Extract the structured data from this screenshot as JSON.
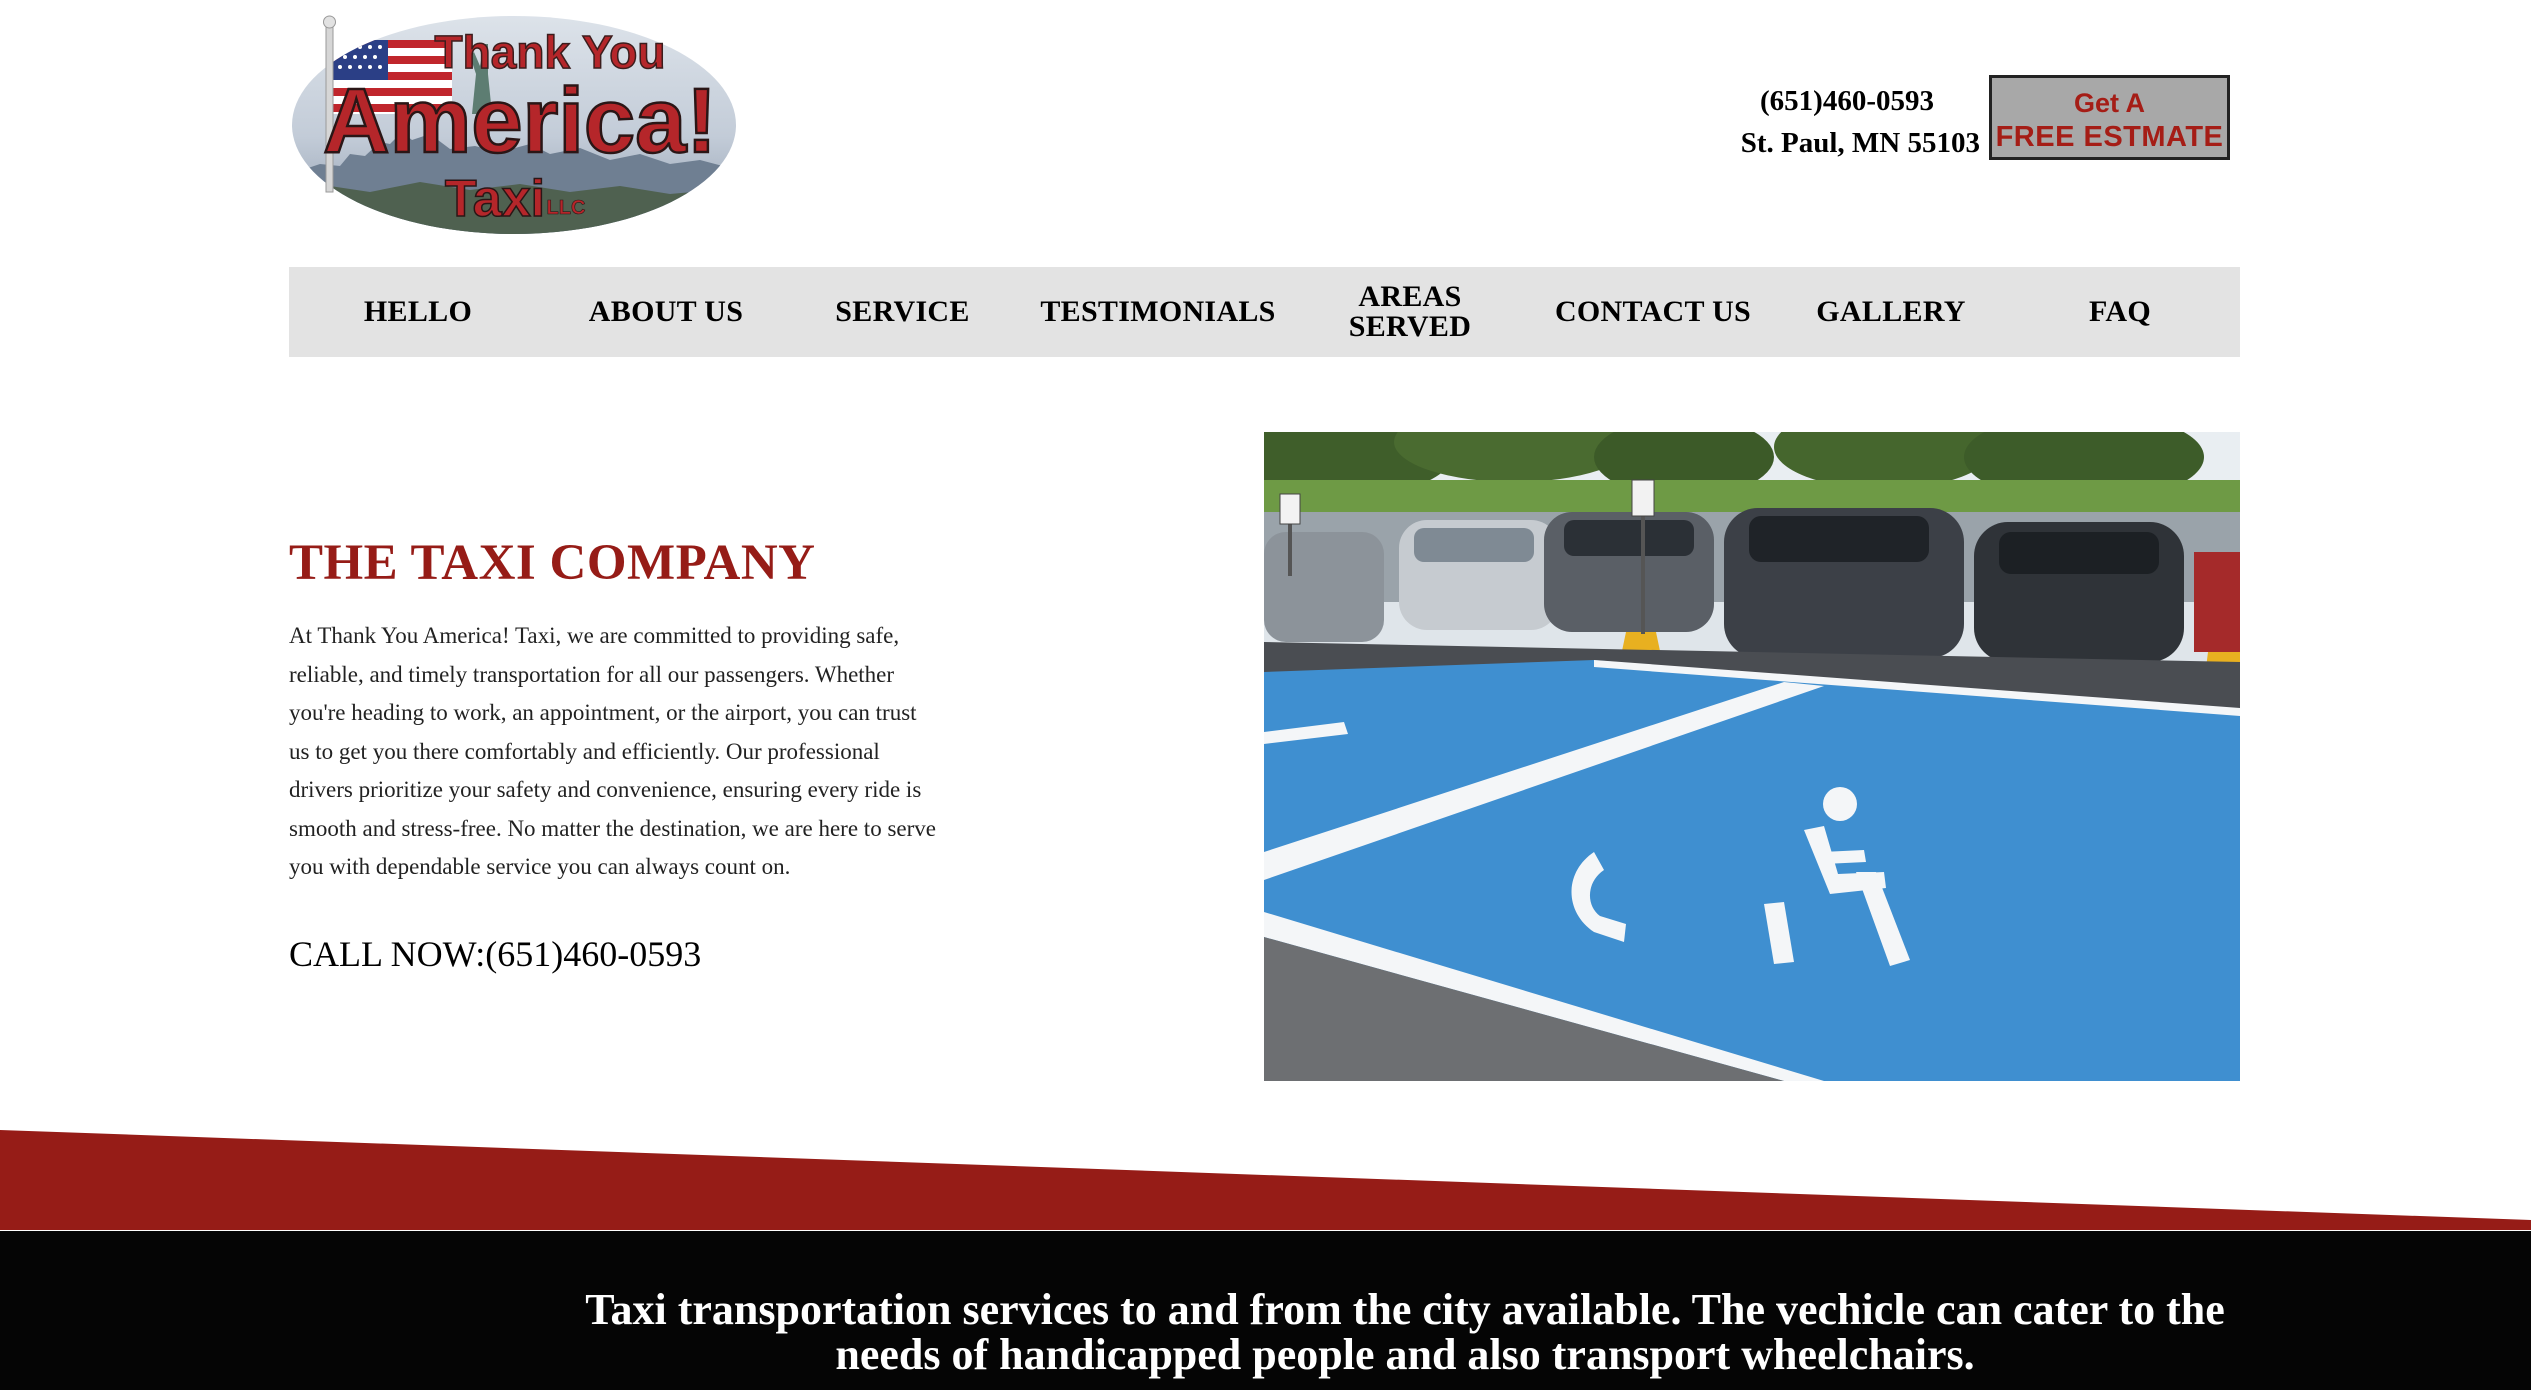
{
  "header": {
    "logo": {
      "line1": "Thank You",
      "line2": "America!",
      "line3": "Taxi",
      "suffix": "LLC",
      "icon": "flag-and-statue-of-liberty-logo"
    },
    "phone": "(651)460-0593",
    "address": "St. Paul, MN 55103",
    "estimate_button": {
      "line1": "Get A",
      "line2": "FREE ESTMATE"
    }
  },
  "nav": {
    "items": [
      {
        "label": "HELLO"
      },
      {
        "label": "ABOUT US"
      },
      {
        "label": "SERVICE"
      },
      {
        "label": "TESTIMONIALS"
      },
      {
        "label_line1": "AREAS",
        "label_line2": "SERVED"
      },
      {
        "label": "CONTACT US"
      },
      {
        "label": "GALLERY"
      },
      {
        "label": "FAQ"
      }
    ]
  },
  "hero": {
    "title": "THE TAXI COMPANY",
    "body": "At Thank You America! Taxi, we are committed to providing safe, reliable, and timely transportation for all our passengers. Whether you're heading to work, an appointment, or the airport, you can trust us to get you there comfortably and efficiently. Our professional drivers prioritize your safety and convenience, ensuring every ride is smooth and stress-free. No matter the destination, we are here to serve you with dependable service you can always count on.",
    "call_now": "CALL NOW:(651)460-0593",
    "photo": "handicapped-parking-lot-photo"
  },
  "banner": {
    "text": "Taxi transportation services to and from the city available. The vechicle can cater to the needs of handicapped people and also transport wheelchairs."
  },
  "colors": {
    "brand_red": "#961c17",
    "nav_bg": "#e3e3e3",
    "button_bg": "#a8a8a8",
    "button_text": "#a51d16",
    "footer_bg": "#050505",
    "parking_blue": "#3f8fd0"
  }
}
